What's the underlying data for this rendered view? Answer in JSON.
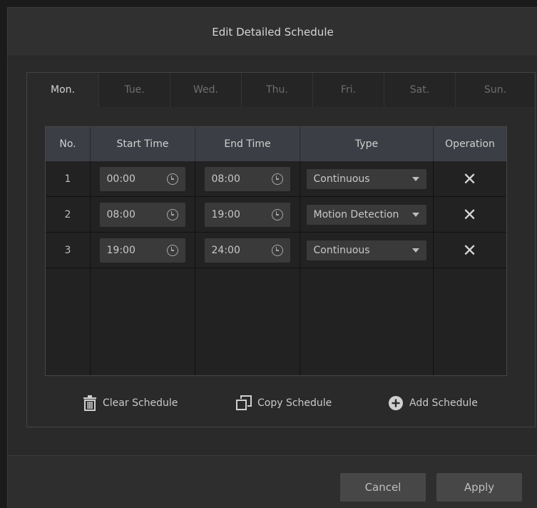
{
  "dialog": {
    "title": "Edit Detailed Schedule"
  },
  "tabs": [
    {
      "label": "Mon.",
      "active": true
    },
    {
      "label": "Tue.",
      "active": false
    },
    {
      "label": "Wed.",
      "active": false
    },
    {
      "label": "Thu.",
      "active": false
    },
    {
      "label": "Fri.",
      "active": false
    },
    {
      "label": "Sat.",
      "active": false
    },
    {
      "label": "Sun.",
      "active": false
    }
  ],
  "table": {
    "headers": [
      "No.",
      "Start Time",
      "End Time",
      "Type",
      "Operation"
    ],
    "rows": [
      {
        "no": "1",
        "start": "00:00",
        "end": "08:00",
        "type": "Continuous"
      },
      {
        "no": "2",
        "start": "08:00",
        "end": "19:00",
        "type": "Motion Detection"
      },
      {
        "no": "3",
        "start": "19:00",
        "end": "24:00",
        "type": "Continuous"
      }
    ]
  },
  "actions": {
    "clear": "Clear Schedule",
    "copy": "Copy Schedule",
    "add": "Add Schedule"
  },
  "footer": {
    "cancel": "Cancel",
    "apply": "Apply"
  },
  "icons": {
    "clock": "clock-icon",
    "close": "close-icon",
    "dropdown": "caret-down-icon",
    "trash": "trash-icon",
    "copy": "copy-icon",
    "add": "plus-circle-icon"
  },
  "colors": {
    "background": "#2a2a2a",
    "header": "#3b3e44",
    "field": "#3a3a3a",
    "button": "#474747"
  }
}
